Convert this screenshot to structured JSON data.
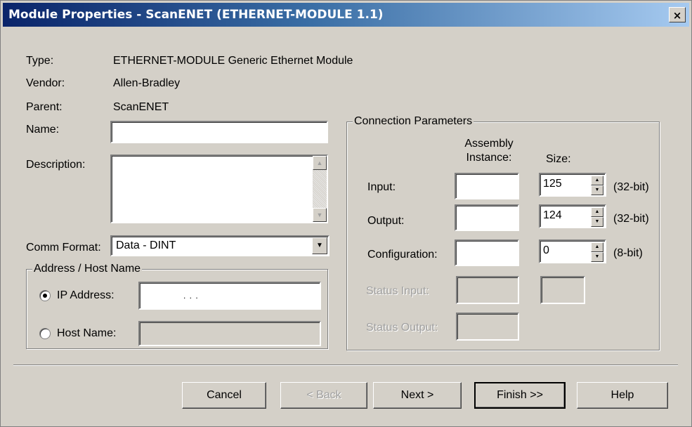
{
  "window": {
    "title": "Module Properties  - ScanENET (ETHERNET-MODULE 1.1)",
    "close_glyph": "×"
  },
  "info": [
    {
      "label": "Type:",
      "value": "ETHERNET-MODULE Generic Ethernet Module"
    },
    {
      "label": "Vendor:",
      "value": "Allen-Bradley"
    },
    {
      "label": "Parent:",
      "value": "ScanENET"
    }
  ],
  "name": {
    "label": "Name:",
    "value": ""
  },
  "description": {
    "label": "Description:",
    "value": ""
  },
  "comm_format": {
    "label": "Comm Format:",
    "value": "Data - DINT"
  },
  "address": {
    "group_title": "Address / Host Name",
    "ip_label": "IP Address:",
    "ip_value": ".        .        .",
    "host_label": "Host Name:",
    "host_value": "",
    "selected": "ip"
  },
  "connection": {
    "group_title": "Connection Parameters",
    "col_instance": "Assembly Instance:",
    "col_size": "Size:",
    "rows": [
      {
        "label": "Input:",
        "instance": "",
        "size": "125",
        "unit": "(32-bit)"
      },
      {
        "label": "Output:",
        "instance": "",
        "size": "124",
        "unit": "(32-bit)"
      },
      {
        "label": "Configuration:",
        "instance": "",
        "size": "0",
        "unit": "(8-bit)"
      },
      {
        "label": "Status Input:",
        "instance": "",
        "size": ""
      },
      {
        "label": "Status Output:",
        "instance": ""
      }
    ]
  },
  "buttons": {
    "cancel": "Cancel",
    "back": "< Back",
    "next": "Next >",
    "finish": "Finish >>",
    "help": "Help"
  }
}
